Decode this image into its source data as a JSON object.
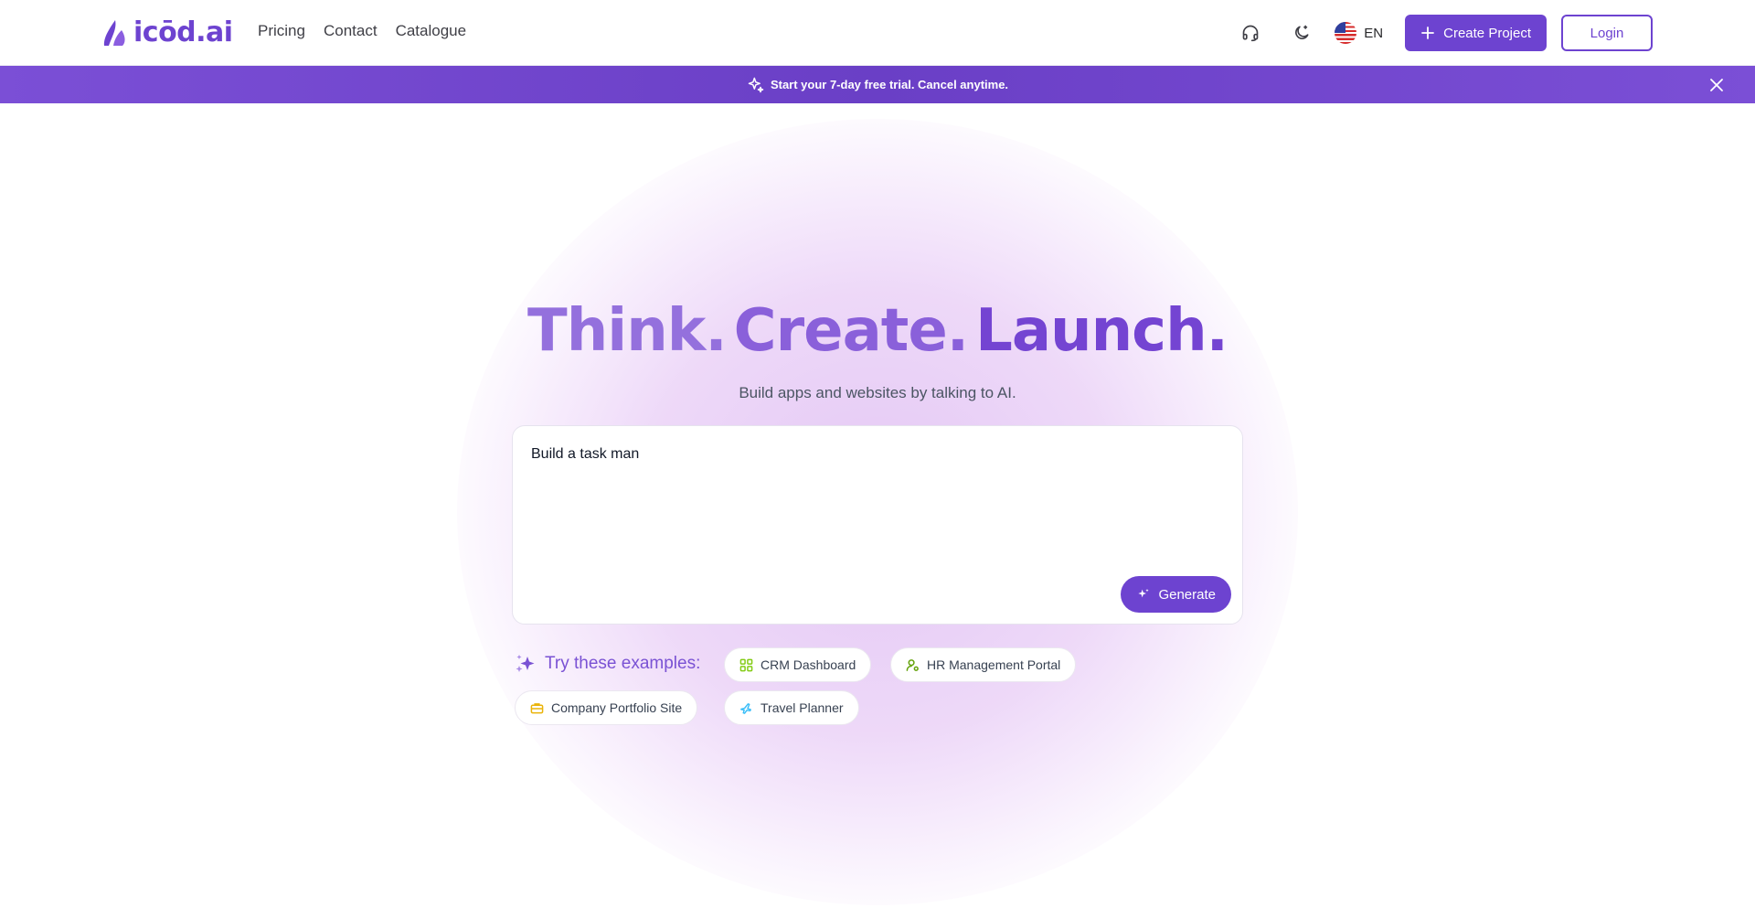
{
  "header": {
    "logo_text": "icōd.ai",
    "nav": [
      "Pricing",
      "Contact",
      "Catalogue"
    ],
    "support_icon": "headset-icon",
    "theme_icon": "moon-icon",
    "language": "EN",
    "create_label": "Create Project",
    "login_label": "Login"
  },
  "banner": {
    "text": "Start your 7-day free trial. Cancel anytime.",
    "icon": "sparkle-icon"
  },
  "hero": {
    "title_1": "Think.",
    "title_2": "Create.",
    "title_3": "Launch.",
    "subtitle": "Build apps and websites by talking to AI.",
    "prompt_value": "Build a task man",
    "generate_label": "Generate"
  },
  "examples": {
    "label": "Try these examples:",
    "items": [
      {
        "label": "CRM Dashboard",
        "icon": "dashboard-grid-icon",
        "color": "#84cc16"
      },
      {
        "label": "HR Management Portal",
        "icon": "user-settings-icon",
        "color": "#65a30d"
      },
      {
        "label": "Company Portfolio Site",
        "icon": "briefcase-icon",
        "color": "#eab308"
      },
      {
        "label": "Travel Planner",
        "icon": "plane-icon",
        "color": "#38bdf8"
      }
    ]
  },
  "colors": {
    "primary": "#6d43d0",
    "banner": "#6a3fc6",
    "glow": "#e6c8f5"
  }
}
